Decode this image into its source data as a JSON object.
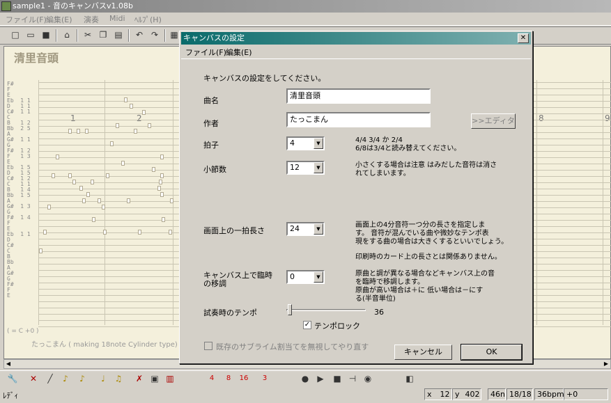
{
  "window": {
    "title": "sample1 - 音のキャンバスv1.08b"
  },
  "menu": [
    "ファイル(F)",
    "編集(E)",
    "演奏",
    "Midi",
    "ﾍﾙﾌﾟ(H)"
  ],
  "toolbar_icons": [
    "new-file-icon",
    "open-folder-icon",
    "save-icon",
    "import-icon",
    "cut-icon",
    "copy-icon",
    "paste-icon",
    "undo-icon",
    "redo-icon",
    "print-icon"
  ],
  "canvas": {
    "song_title": "清里音頭",
    "measures": [
      "1",
      "2",
      "8",
      "9"
    ],
    "note_labels": "F#\nF\nE\nEb  1 1\nD   1 1\nC#  1 1\nC\nB   1 2\nBb  2 5\nA\nG#  1 1\nG\nF#  1 2\nF   1 3\nE\nEb  1 5\nD   1 5\nC#  1 2\nC   1 1\nB   1 4\nBb  1 5\nA\nG#  1 3\nG\nF#  1 4\nF\nE\nEb  1 1\nD\nC#\nC\nB\nBb\nA\nG#\nG\nF#\nF\nE",
    "footer_range": "( = C +0 )",
    "footer_author": "たっこまん  ( making 18note Cylinder type)"
  },
  "dialog": {
    "title": "キャンバスの設定",
    "menu": [
      "ファイル(F)",
      "編集(E)"
    ],
    "instruction": "キャンバスの設定をしてください。",
    "song_name_label": "曲名",
    "song_name_value": "清里音頭",
    "author_label": "作者",
    "author_value": "たっこまん",
    "editor_button": ">>エディタ",
    "time_sig_label": "拍子",
    "time_sig_value": "4",
    "time_sig_help": "4/4 3/4 か 2/4\n6/8は3/4と読み替えてください。",
    "measures_label": "小節数",
    "measures_value": "12",
    "measures_help": "小さくする場合は注意 はみだした音符は消さ\nれてしまいます。",
    "beat_len_label": "画面上の一拍長さ",
    "beat_len_value": "24",
    "beat_len_help": "画面上の4分音符一つ分の長さを指定しま\nす。 音符が混んでいる曲や微妙なテンポ表\n現をする曲の場合は大きくするといいでしょう。",
    "print_help": "印刷時のカード上の長さとは関係ありません。",
    "transpose_label": "キャンバス上で臨時\nの移調",
    "transpose_value": "0",
    "transpose_help": "原曲と調が異なる場合などキャンバス上の音\nを臨時で移調します。\n原曲が高い場合は＋に 低い場合は－にす\nる(半音単位)",
    "tempo_label": "試奏時のテンポ",
    "tempo_value": "36",
    "tempo_fraction": 0.02,
    "tempo_lock_label": "テンポロック",
    "tempo_lock_checked": "✓",
    "sublime_label": "既存のサブライム割当てを無視してやり直す",
    "cancel_button": "キャンセル",
    "ok_button": "OK"
  },
  "bottom_icons": [
    "wrench-icon",
    "eraser-icon",
    "line-icon",
    "tie-icon",
    "tie2-icon",
    "note-icon",
    "double-note-icon",
    "delete-icon",
    "grid-icon",
    "measure-icon",
    "note-4-icon",
    "note-8-icon",
    "note-16-icon",
    "triplet-icon",
    "record-icon",
    "play-icon",
    "stop-icon",
    "step-icon",
    "metronome-icon",
    "export-icon"
  ],
  "status": {
    "text": "ﾚﾃﾞｨ",
    "x_label": "x",
    "x_value": "12",
    "y_label": "y",
    "y_value": "402",
    "note": "46n",
    "page": "18/18",
    "bpm": "36bpm",
    "offset": "+0"
  }
}
